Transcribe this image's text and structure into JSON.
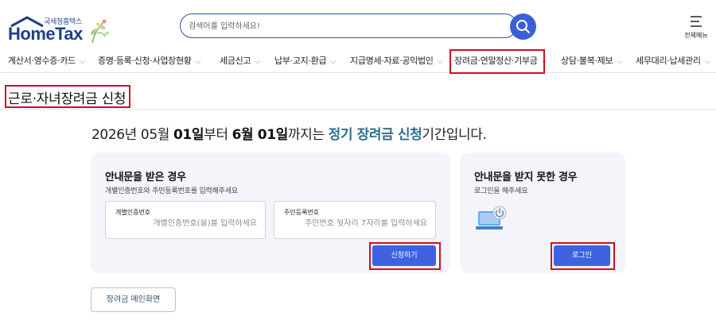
{
  "header": {
    "logo_small": "국세청홈택스",
    "logo_main": "HomeTax",
    "search_placeholder": "검색어를 입력하세요!",
    "menu_all_label": "전체메뉴"
  },
  "nav": {
    "items": [
      {
        "label": "계산서·영수증·카드"
      },
      {
        "label": "증명·등록·신청·사업장현황"
      },
      {
        "label": "세금신고"
      },
      {
        "label": "납부·고지·환급"
      },
      {
        "label": "지급명세·자료·공익법인"
      },
      {
        "label": "장려금·연말정산·기부금"
      },
      {
        "label": "상담·불복·제보"
      },
      {
        "label": "세무대리·납세관리"
      }
    ],
    "selected_index": 5
  },
  "page_title": "근로·자녀장려금 신청",
  "headline": {
    "part1": "2026년 05월 ",
    "day1": "01일",
    "part2": "부터 ",
    "date2": "6월 01일",
    "part3": "까지는 ",
    "accent": "정기 장려금 신청",
    "part4": "기간입니다."
  },
  "card_notice": {
    "title": "안내문을 받은 경우",
    "subtitle": "개별인증번호와 주민등록번호를 입력해주세요",
    "field1_label": "개별인증번호",
    "field1_placeholder": "개별인증번호(을)를 입력하세요",
    "field2_label": "주민등록번호",
    "field2_placeholder": "주민번호 뒷자리 7자리를 입력하세요",
    "apply_button": "신청하기"
  },
  "card_no_notice": {
    "title": "안내문을 받지 못한 경우",
    "subtitle": "로그인을 해주세요",
    "login_button": "로그인"
  },
  "main_button": "장려금 메인화면",
  "colors": {
    "brand_blue": "#3d63e0",
    "highlight_red": "#d0101e",
    "card_bg": "#f3f5fa"
  }
}
